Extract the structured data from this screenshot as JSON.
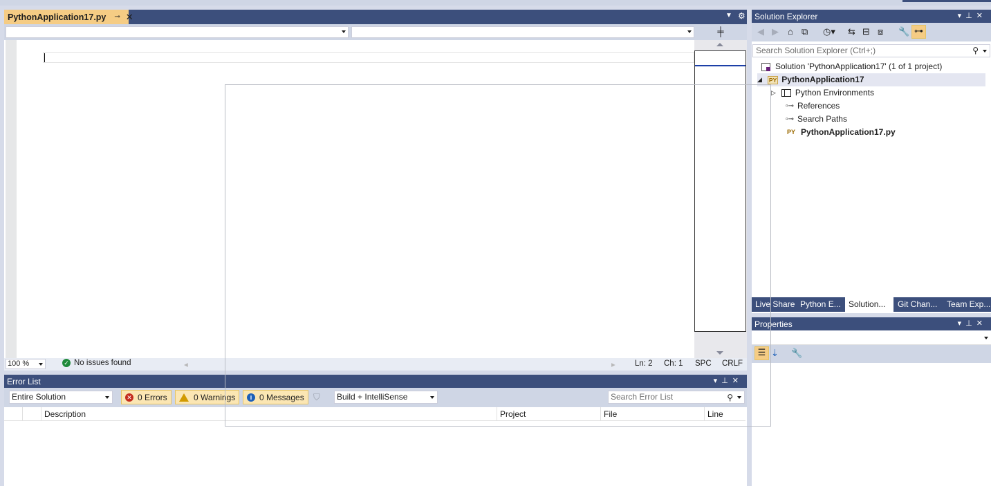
{
  "editor": {
    "tab_name": "PythonApplication17.py",
    "pin_glyph": "⊸",
    "close_glyph": "✕",
    "zoom": "100 %",
    "issues": "No issues found",
    "ln": "Ln: 2",
    "ch": "Ch: 1",
    "spc": "SPC",
    "crlf": "CRLF"
  },
  "error_list": {
    "title": "Error List",
    "scope": "Entire Solution",
    "errors": "0 Errors",
    "warnings": "0 Warnings",
    "messages": "0 Messages",
    "build_filter": "Build + IntelliSense",
    "search_placeholder": "Search Error List",
    "columns": [
      "Description",
      "Project",
      "File",
      "Line"
    ]
  },
  "solution_explorer": {
    "title": "Solution Explorer",
    "search_placeholder": "Search Solution Explorer (Ctrl+;)",
    "tree": {
      "solution": "Solution 'PythonApplication17' (1 of 1 project)",
      "project": "PythonApplication17",
      "environments": "Python Environments",
      "references": "References",
      "search_paths": "Search Paths",
      "file": "PythonApplication17.py"
    },
    "py_badge": "PY",
    "tabs": [
      "Live Share",
      "Python E...",
      "Solution...",
      "Git Chan...",
      "Team Exp..."
    ]
  },
  "properties": {
    "title": "Properties"
  },
  "colors": {
    "title_bar": "#3c4f7c",
    "active_tab": "#f5cc84",
    "toolbar": "#cfd6e5"
  }
}
